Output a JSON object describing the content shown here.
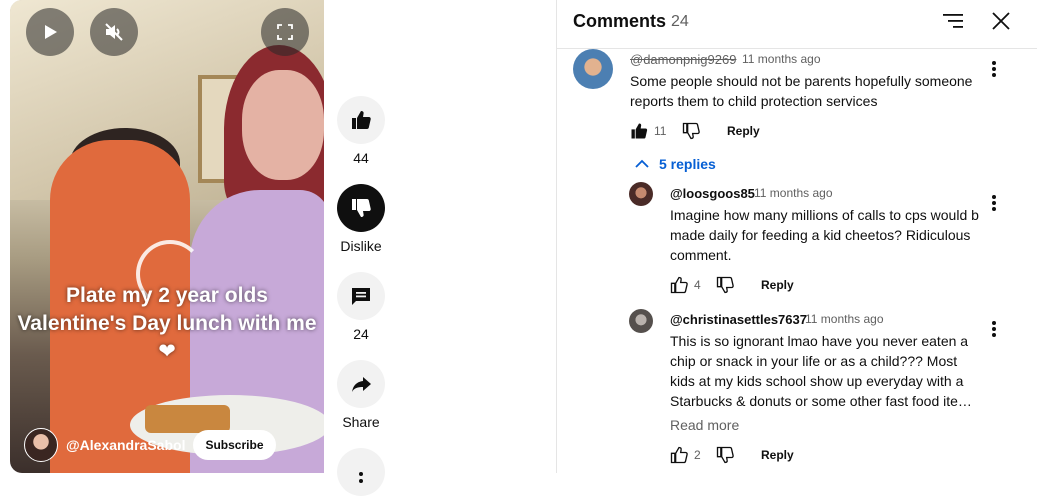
{
  "video": {
    "overlay_text": "Plate my 2 year olds Valentine's Day lunch with me ❤",
    "channel": "@AlexandraSabol",
    "subscribe_label": "Subscribe",
    "icons": [
      "play-icon",
      "mute-icon",
      "fullscreen-icon"
    ]
  },
  "actions": {
    "like_count": "44",
    "dislike_label": "Dislike",
    "comment_count": "24",
    "share_label": "Share"
  },
  "comments_panel": {
    "title": "Comments",
    "count": "24",
    "comments": [
      {
        "author": "@damonpnig9269",
        "time": "11 months ago",
        "text": "Some people should not be parents hopefully someone reports them to child protection services",
        "likes": "11",
        "reply_label": "Reply",
        "replies_toggle": "5 replies"
      }
    ],
    "replies": [
      {
        "author": "@loosgoos85",
        "time": "11 months ago",
        "text": "Imagine how many millions of calls to cps would b made daily for feeding a kid cheetos? Ridiculous comment.",
        "likes": "4",
        "reply_label": "Reply"
      },
      {
        "author": "@christinasettles7637",
        "time": "11 months ago",
        "text": "This is so ignorant lmao have you never eaten a chip or snack in your life or as a child??? Most kids at my kids school show up everyday with a Starbucks & donuts or some other fast food ite…",
        "read_more": "Read more",
        "likes": "2",
        "reply_label": "Reply"
      }
    ]
  },
  "colors": {
    "link": "#065fd4",
    "secondary_text": "#606060",
    "primary_text": "#0f0f0f"
  }
}
